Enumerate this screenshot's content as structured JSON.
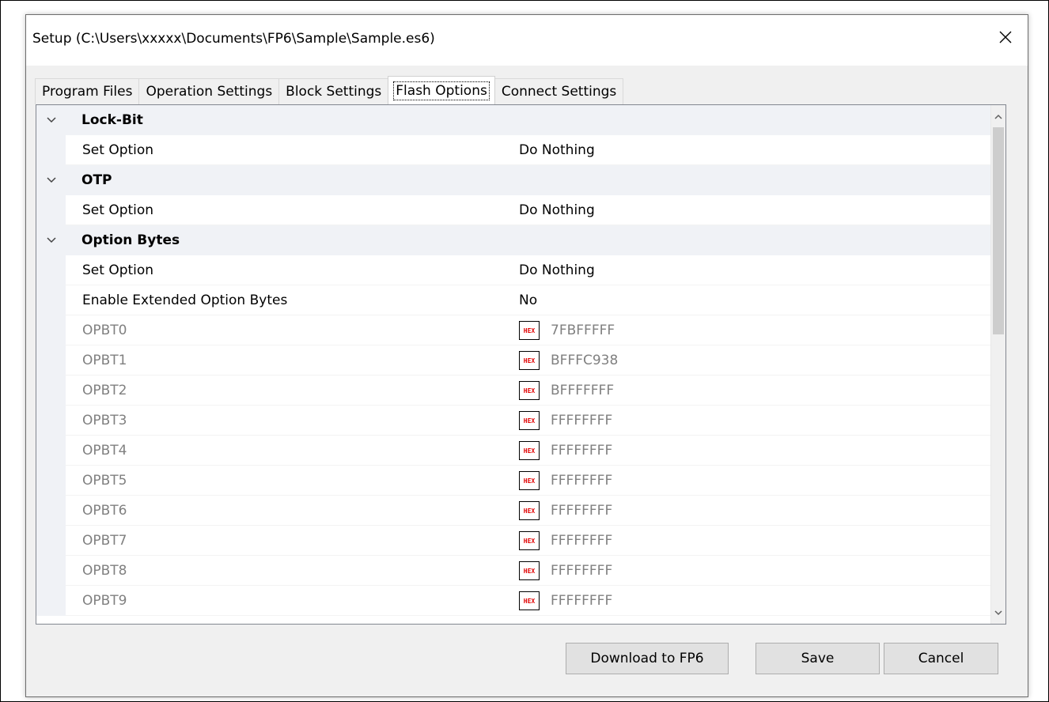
{
  "window": {
    "title": "Setup (C:\\Users\\xxxxx\\Documents\\FP6\\Sample\\Sample.es6)"
  },
  "tabs": [
    {
      "label": "Program Files",
      "active": false
    },
    {
      "label": "Operation Settings",
      "active": false
    },
    {
      "label": "Block Settings",
      "active": false
    },
    {
      "label": "Flash Options",
      "active": true
    },
    {
      "label": "Connect Settings",
      "active": false
    }
  ],
  "grid": {
    "lockbit": {
      "label": "Lock-Bit",
      "set_option_name": "Set Option",
      "set_option_value": "Do Nothing"
    },
    "otp": {
      "label": "OTP",
      "set_option_name": "Set Option",
      "set_option_value": "Do Nothing"
    },
    "option_bytes": {
      "label": "Option Bytes",
      "set_option_name": "Set Option",
      "set_option_value": "Do Nothing",
      "extended_name": "Enable Extended Option Bytes",
      "extended_value": "No",
      "hex_badge": "HEX",
      "opbt": [
        {
          "name": "OPBT0",
          "value": "7FBFFFFF"
        },
        {
          "name": "OPBT1",
          "value": "BFFFC938"
        },
        {
          "name": "OPBT2",
          "value": "BFFFFFFF"
        },
        {
          "name": "OPBT3",
          "value": "FFFFFFFF"
        },
        {
          "name": "OPBT4",
          "value": "FFFFFFFF"
        },
        {
          "name": "OPBT5",
          "value": "FFFFFFFF"
        },
        {
          "name": "OPBT6",
          "value": "FFFFFFFF"
        },
        {
          "name": "OPBT7",
          "value": "FFFFFFFF"
        },
        {
          "name": "OPBT8",
          "value": "FFFFFFFF"
        },
        {
          "name": "OPBT9",
          "value": "FFFFFFFF"
        }
      ]
    }
  },
  "buttons": {
    "download": "Download to FP6",
    "save": "Save",
    "cancel": "Cancel"
  },
  "icons": {
    "close": "close-icon",
    "collapse": "chevron-down-icon",
    "scroll_up": "chevron-up-icon",
    "scroll_down": "chevron-down-icon"
  },
  "colors": {
    "category_bg": "#f0f2f6",
    "hex_badge_text": "#e00000",
    "dim_text": "#808080"
  }
}
